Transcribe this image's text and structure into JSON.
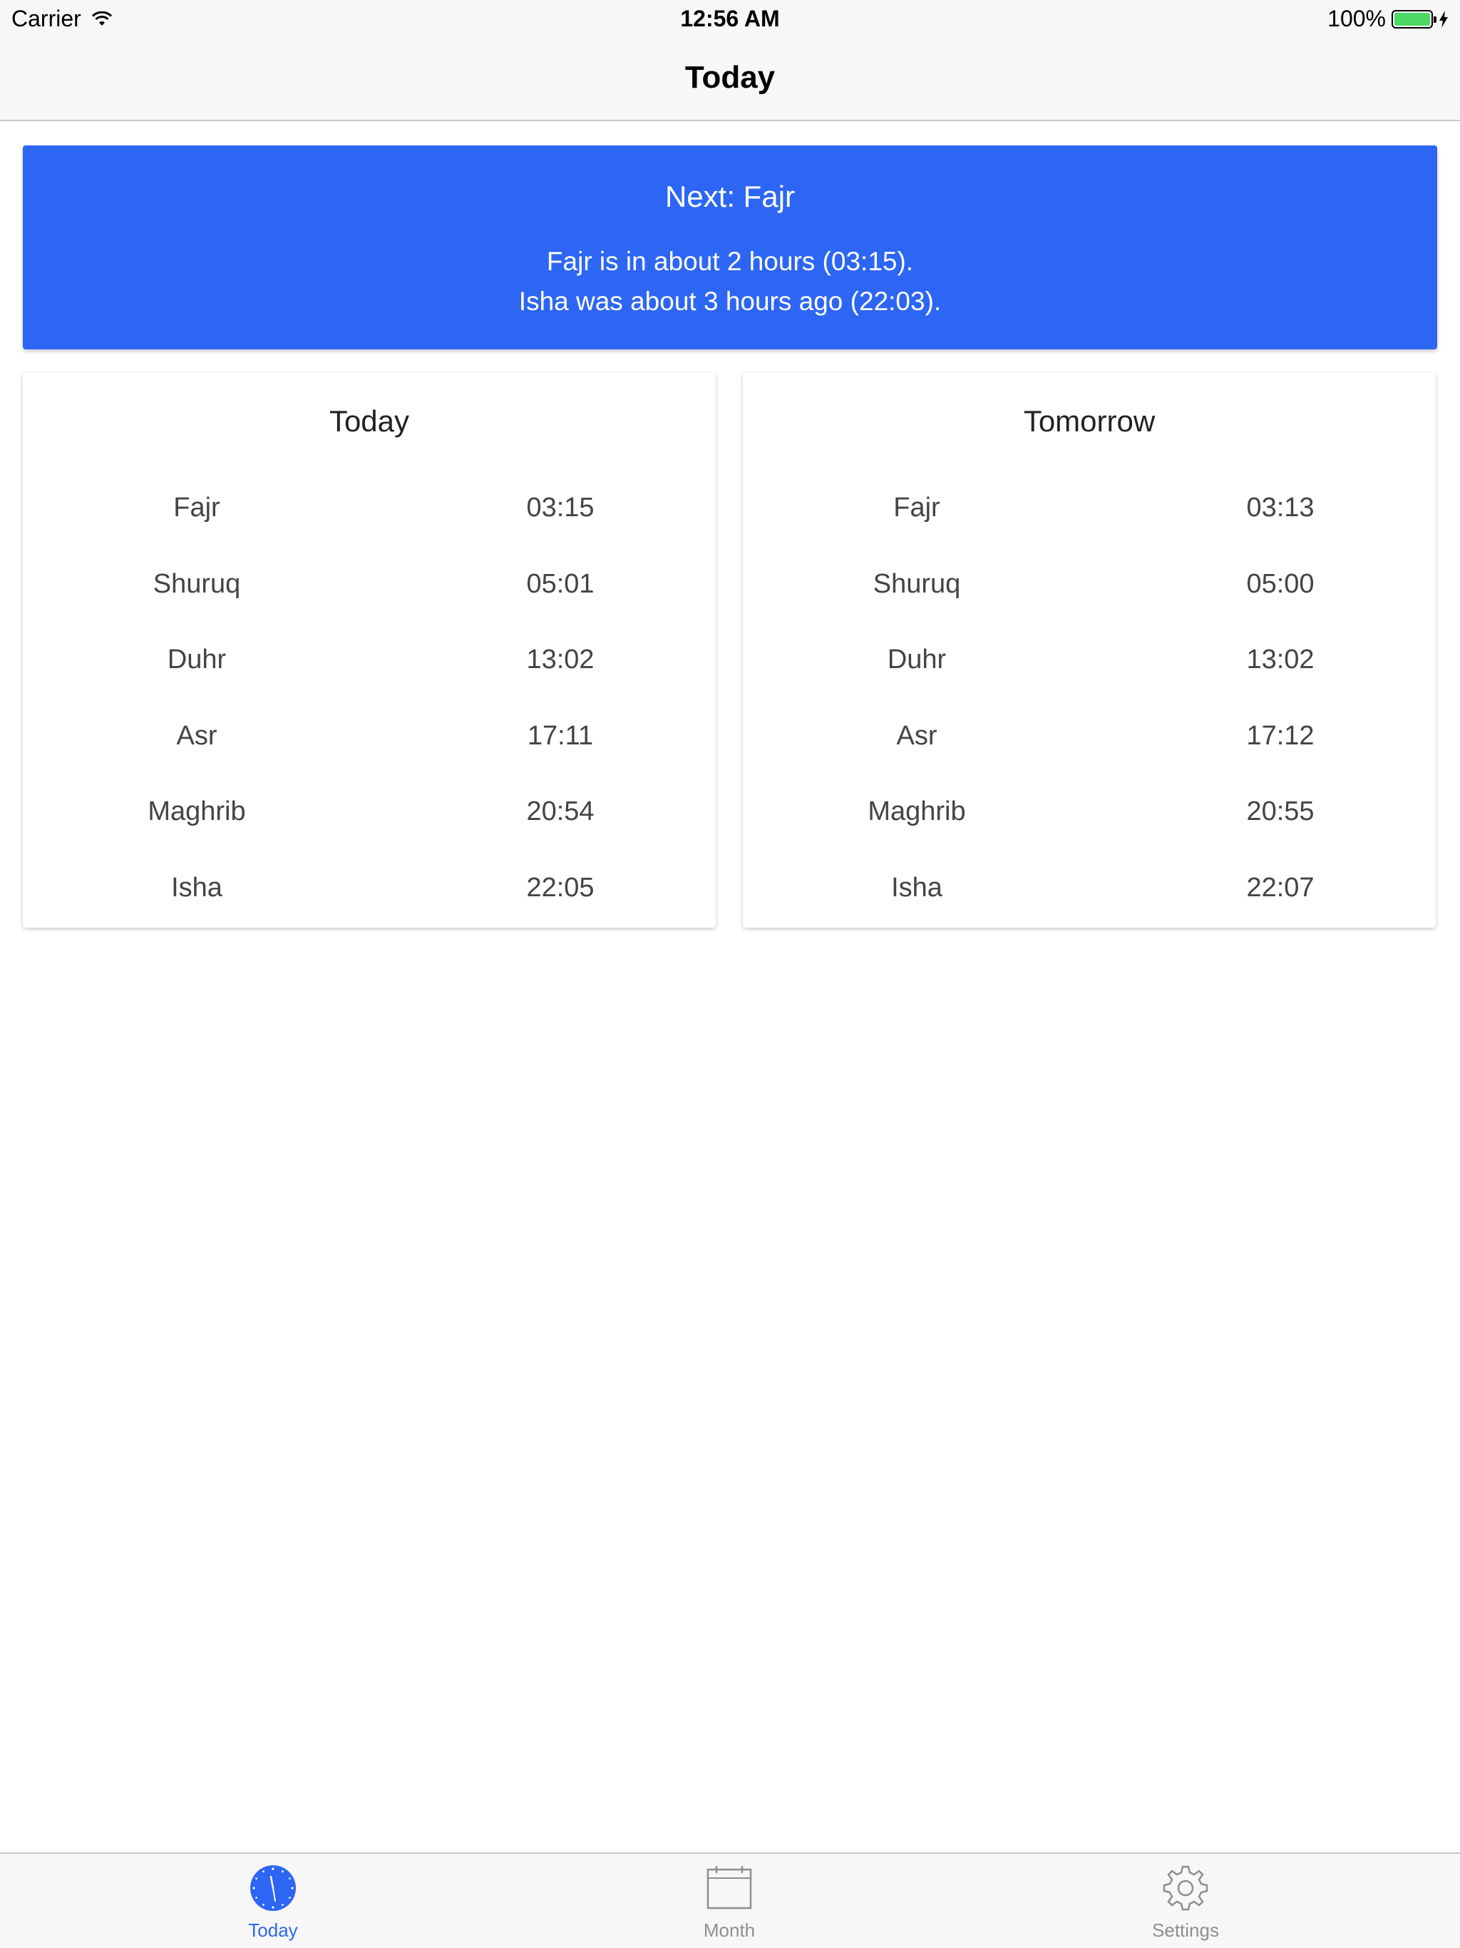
{
  "status_bar": {
    "carrier": "Carrier",
    "time": "12:56 AM",
    "battery": "100%",
    "battery_level": 1.0
  },
  "nav": {
    "title": "Today"
  },
  "banner": {
    "title": "Next: Fajr",
    "line1": "Fajr is in about 2 hours (03:15).",
    "line2": "Isha was about 3 hours ago (22:03).",
    "color": "#2d66f4"
  },
  "today": {
    "title": "Today",
    "rows": [
      {
        "name": "Fajr",
        "time": "03:15"
      },
      {
        "name": "Shuruq",
        "time": "05:01"
      },
      {
        "name": "Duhr",
        "time": "13:02"
      },
      {
        "name": "Asr",
        "time": "17:11"
      },
      {
        "name": "Maghrib",
        "time": "20:54"
      },
      {
        "name": "Isha",
        "time": "22:05"
      }
    ]
  },
  "tomorrow": {
    "title": "Tomorrow",
    "rows": [
      {
        "name": "Fajr",
        "time": "03:13"
      },
      {
        "name": "Shuruq",
        "time": "05:00"
      },
      {
        "name": "Duhr",
        "time": "13:02"
      },
      {
        "name": "Asr",
        "time": "17:12"
      },
      {
        "name": "Maghrib",
        "time": "20:55"
      },
      {
        "name": "Isha",
        "time": "22:07"
      }
    ]
  },
  "tabs": [
    {
      "label": "Today",
      "icon": "clock-icon",
      "active": true
    },
    {
      "label": "Month",
      "icon": "calendar-icon",
      "active": false
    },
    {
      "label": "Settings",
      "icon": "gear-icon",
      "active": false
    }
  ],
  "colors": {
    "accent": "#2d66f4",
    "battery_green": "#4cd964",
    "inactive_tab": "#8e8e93"
  }
}
